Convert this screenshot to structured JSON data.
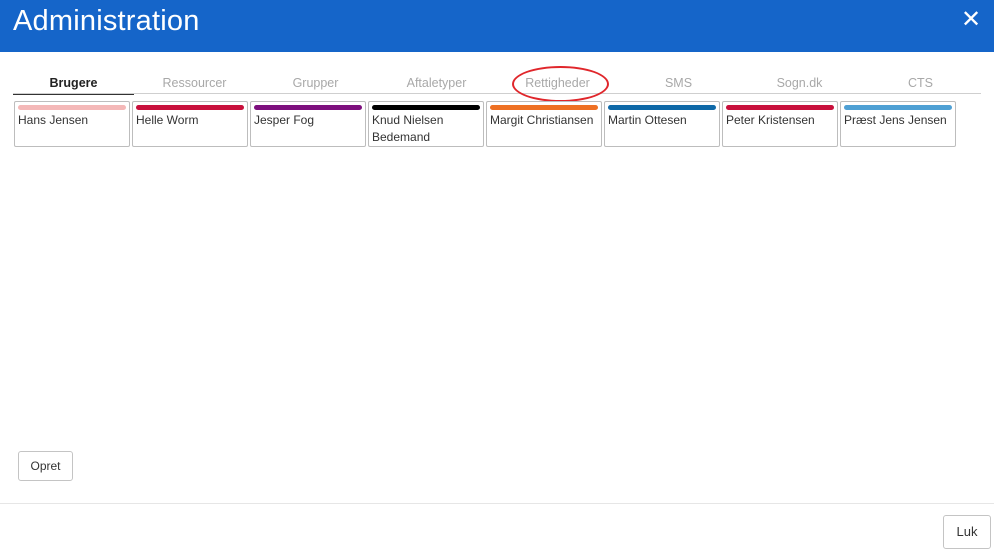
{
  "header": {
    "title": "Administration",
    "close_glyph": "✕",
    "background": "#1565c9"
  },
  "tabs": [
    {
      "label": "Brugere",
      "active": true
    },
    {
      "label": "Ressourcer",
      "active": false
    },
    {
      "label": "Grupper",
      "active": false
    },
    {
      "label": "Aftaletyper",
      "active": false
    },
    {
      "label": "Rettigheder",
      "active": false,
      "highlighted": true
    },
    {
      "label": "SMS",
      "active": false
    },
    {
      "label": "Sogn.dk",
      "active": false
    },
    {
      "label": "CTS",
      "active": false
    }
  ],
  "highlight_color": "#e0262b",
  "users": [
    {
      "name": "Hans Jensen",
      "color": "#f4b8b8"
    },
    {
      "name": "Helle Worm",
      "color": "#c8103c"
    },
    {
      "name": "Jesper Fog",
      "color": "#7d0f7d"
    },
    {
      "name": "Knud Nielsen Bedemand",
      "color": "#000000"
    },
    {
      "name": "Margit Christiansen",
      "color": "#ee7023"
    },
    {
      "name": "Martin Ottesen",
      "color": "#0f69a8"
    },
    {
      "name": "Peter Kristensen",
      "color": "#c8103c"
    },
    {
      "name": "Præst Jens Jensen",
      "color": "#4fa0d4"
    }
  ],
  "actions": {
    "create_label": "Opret",
    "close_label": "Luk"
  }
}
